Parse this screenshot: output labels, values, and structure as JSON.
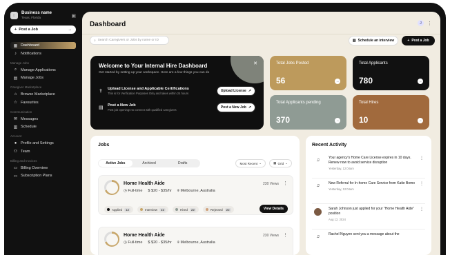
{
  "sidebar": {
    "business_name": "Business name",
    "business_location": "Texas, Florida",
    "post_job": "Post a Job",
    "groups": [
      {
        "head": "",
        "items": [
          {
            "label": "Dashboard",
            "icon": "grid-icon",
            "active": true
          },
          {
            "label": "Notifications",
            "icon": "bell-icon",
            "active": false
          }
        ]
      },
      {
        "head": "Manage Jobs",
        "items": [
          {
            "label": "Manage Applications",
            "icon": "search-icon",
            "active": false
          },
          {
            "label": "Manage Jobs",
            "icon": "briefcase-icon",
            "active": false
          }
        ]
      },
      {
        "head": "Caregiver Marketplace",
        "items": [
          {
            "label": "Browse Marketplace",
            "icon": "store-icon",
            "active": false
          },
          {
            "label": "Favourites",
            "icon": "star-icon",
            "active": false
          }
        ]
      },
      {
        "head": "Communication",
        "items": [
          {
            "label": "Messages",
            "icon": "message-icon",
            "active": false
          },
          {
            "label": "Schedule",
            "icon": "calendar-icon",
            "active": false
          }
        ]
      },
      {
        "head": "Account",
        "items": [
          {
            "label": "Profile and Settings",
            "icon": "person-icon",
            "active": false
          },
          {
            "label": "Team",
            "icon": "team-icon",
            "active": false
          }
        ]
      },
      {
        "head": "Billing and Invoices",
        "items": [
          {
            "label": "Billing Overview",
            "icon": "billing-icon",
            "active": false
          },
          {
            "label": "Subscription Plans",
            "icon": "card-icon",
            "active": false
          }
        ]
      }
    ]
  },
  "header": {
    "title": "Dashboard",
    "search_placeholder": "Search Caregivers or Jobs by name or ID",
    "schedule_btn": "Schedule an interview",
    "post_btn": "Post a Job"
  },
  "welcome": {
    "title": "Welcome to Your Internal Hire Dashboard",
    "subtitle": "Get started by setting up your workspace. Here are a few things you can do",
    "rows": [
      {
        "title": "Upload License and Applicable Certifications",
        "desc": "This is for Verification Purposes Only and takes within 24 hours",
        "button": "Upload License"
      },
      {
        "title": "Post a New Job",
        "desc": "Post job openings to connect with qualified caregivers",
        "button": "Post a New Job"
      }
    ]
  },
  "stats": [
    {
      "label": "Total Jobs Posted",
      "value": "56",
      "color": "#bd9a5c"
    },
    {
      "label": "Total Applicants",
      "value": "780",
      "color": "#111111"
    },
    {
      "label": "Total Applicants pending",
      "value": "370",
      "color": "#8f9b94"
    },
    {
      "label": "Total Hires",
      "value": "10",
      "color": "#a16a3d"
    }
  ],
  "jobs": {
    "title": "Jobs",
    "tabs": [
      "Active Jobs",
      "Archived",
      "Drafts"
    ],
    "filters": [
      "Most Recent",
      "Grid"
    ],
    "cards": [
      {
        "title": "Home Health Aide",
        "type": "Full-time",
        "pay": "$20 - $35/hr",
        "location": "Melbourne, Australia",
        "views": "230 Views",
        "pills": [
          {
            "label": "Applied",
            "count": "12",
            "color": "#111111"
          },
          {
            "label": "Interview",
            "count": "22",
            "color": "#c7a66a"
          },
          {
            "label": "Hired",
            "count": "22",
            "color": "#8f9b94"
          },
          {
            "label": "Rejected",
            "count": "22",
            "color": "#cfa07a"
          }
        ],
        "details": "View Details"
      },
      {
        "title": "Home Health Aide",
        "type": "Full-time",
        "pay": "$20 - $35/hr",
        "location": "Melbourne, Australia",
        "views": "230 Views"
      }
    ]
  },
  "activity": {
    "title": "Recent Activity",
    "items": [
      {
        "text": "Your agency's Home Care License expires in 10 days. Renew now to avoid service disruption",
        "time": "Yesterday, 12:04am",
        "avatar": false
      },
      {
        "text": "New Referral for In-home Care Service from Katie Bomo",
        "time": "Yesterday, 12:04am",
        "avatar": false
      },
      {
        "text": "Sarah Johnson just applied for your \"Home Health Aide\" position",
        "time": "Aug 12, 2024",
        "avatar": true
      },
      {
        "text": "Rachel Nguyen sent you a message about the",
        "time": "",
        "avatar": false
      }
    ]
  }
}
